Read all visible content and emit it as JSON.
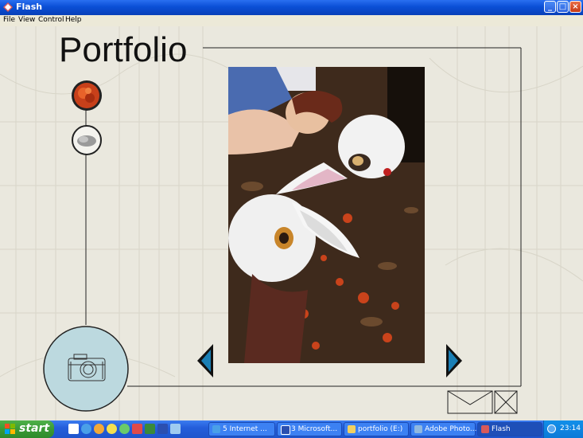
{
  "window": {
    "title": "Flash"
  },
  "menu": [
    {
      "label": "File"
    },
    {
      "label": "View"
    },
    {
      "label": "Control"
    },
    {
      "label": "Help"
    }
  ],
  "content": {
    "title": "Portfolio"
  },
  "colors": {
    "accent_arrow": "#1a7fb5",
    "titlebar": "#0a4fd6",
    "taskbar": "#245edb",
    "start": "#3a9a35",
    "camera_circle": "#bcd9df"
  },
  "taskbar": {
    "start_label": "start",
    "tasks": [
      {
        "label": "5 Internet ...",
        "icon": "ie-icon"
      },
      {
        "label": "3 Microsoft...",
        "icon": "word-icon"
      },
      {
        "label": "portfolio (E:)",
        "icon": "folder-icon"
      },
      {
        "label": "Adobe Photo...",
        "icon": "photoshop-icon"
      },
      {
        "label": "Flash",
        "icon": "flash-icon"
      }
    ],
    "clock": "23:14"
  }
}
